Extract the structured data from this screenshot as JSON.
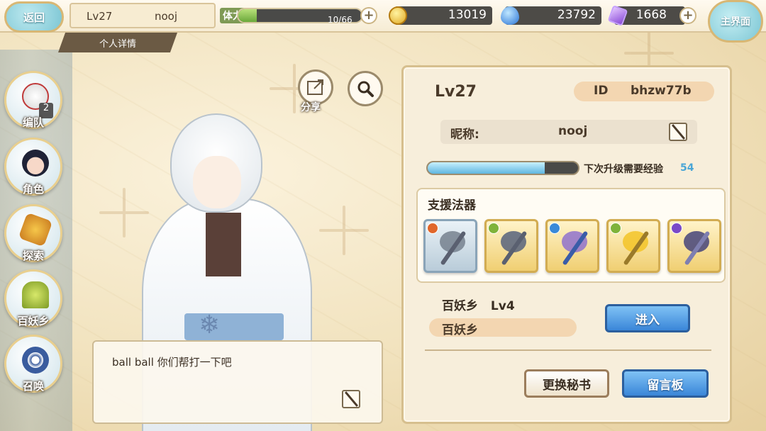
{
  "topbar": {
    "back_label": "返回",
    "home_label": "主界面",
    "level": "Lv27",
    "name": "nooj",
    "detail_tab": "个人详情",
    "stamina_label": "体力",
    "stamina_text": "10/66",
    "stamina_fraction": 0.15,
    "gold": "13019",
    "soul": "23792",
    "crystal": "1668"
  },
  "nav": [
    {
      "label": "编队",
      "badge": "2",
      "icon": "team-icon"
    },
    {
      "label": "角色",
      "icon": "character-icon"
    },
    {
      "label": "探索",
      "icon": "explore-icon"
    },
    {
      "label": "百妖乡",
      "icon": "village-icon"
    },
    {
      "label": "召唤",
      "icon": "summon-icon"
    }
  ],
  "character": {
    "share_label": "分享",
    "speech": "ball  ball 你们帮打一下吧"
  },
  "panel": {
    "level": "Lv27",
    "id_label": "ID",
    "id_value": "bhzw77b",
    "nick_label": "昵称:",
    "nick_value": "nooj",
    "exp_label": "下次升级需要经验",
    "exp_value": "54",
    "exp_fraction": 0.78,
    "support_title": "支援法器",
    "weapons": [
      {
        "name": "axe-weapon",
        "element": "#e0662a"
      },
      {
        "name": "crossbow-weapon",
        "element": "#7fb33a"
      },
      {
        "name": "blade-weapon",
        "element": "#3a8ad8"
      },
      {
        "name": "sword-weapon",
        "element": "#7fb33a"
      },
      {
        "name": "dark-blade-weapon",
        "element": "#7a4ac8"
      }
    ],
    "village_name": "百妖乡",
    "village_level": "Lv4",
    "village_pill": "百妖乡",
    "enter_label": "进入",
    "change_secretary_label": "更换秘书",
    "message_board_label": "留言板"
  },
  "colors": {
    "accent_blue": "#3a86d8",
    "panel_bg": "#f7eedb",
    "pill": "#f3d6b1"
  }
}
